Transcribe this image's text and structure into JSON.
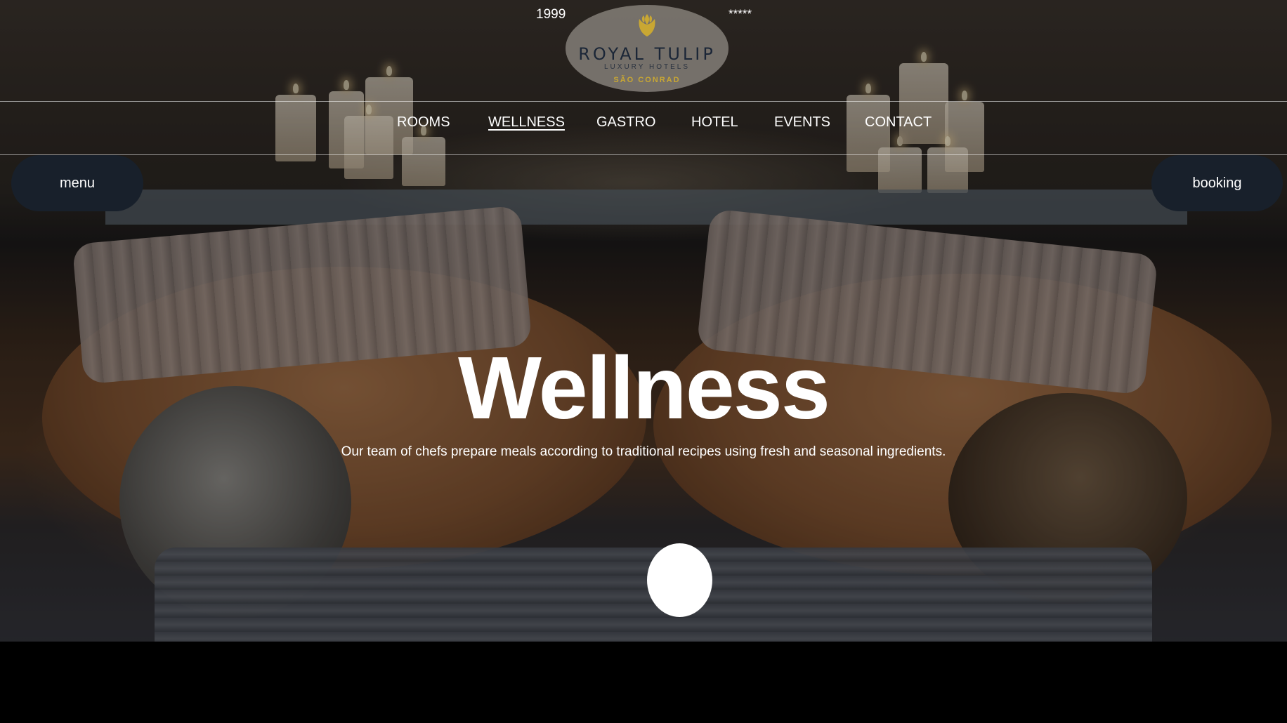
{
  "header": {
    "year": "1999",
    "stars": "*****",
    "logo": {
      "name": "ROYAL TULIP",
      "subtitle": "LUXURY HOTELS",
      "place": "SÃO CONRAD",
      "icon": "tulip-icon",
      "icon_color": "#c9a733"
    }
  },
  "nav": {
    "items": [
      {
        "label": "ROOMS"
      },
      {
        "label": "WELLNESS",
        "active": true
      },
      {
        "label": "GASTRO"
      },
      {
        "label": "HOTEL"
      },
      {
        "label": "EVENTS"
      },
      {
        "label": "CONTACT"
      }
    ]
  },
  "buttons": {
    "menu": "menu",
    "booking": "booking",
    "button_color": "#18202b"
  },
  "hero": {
    "title": "Wellness",
    "subtitle": "Our team of chefs prepare meals according to traditional recipes using fresh and seasonal ingredients."
  }
}
